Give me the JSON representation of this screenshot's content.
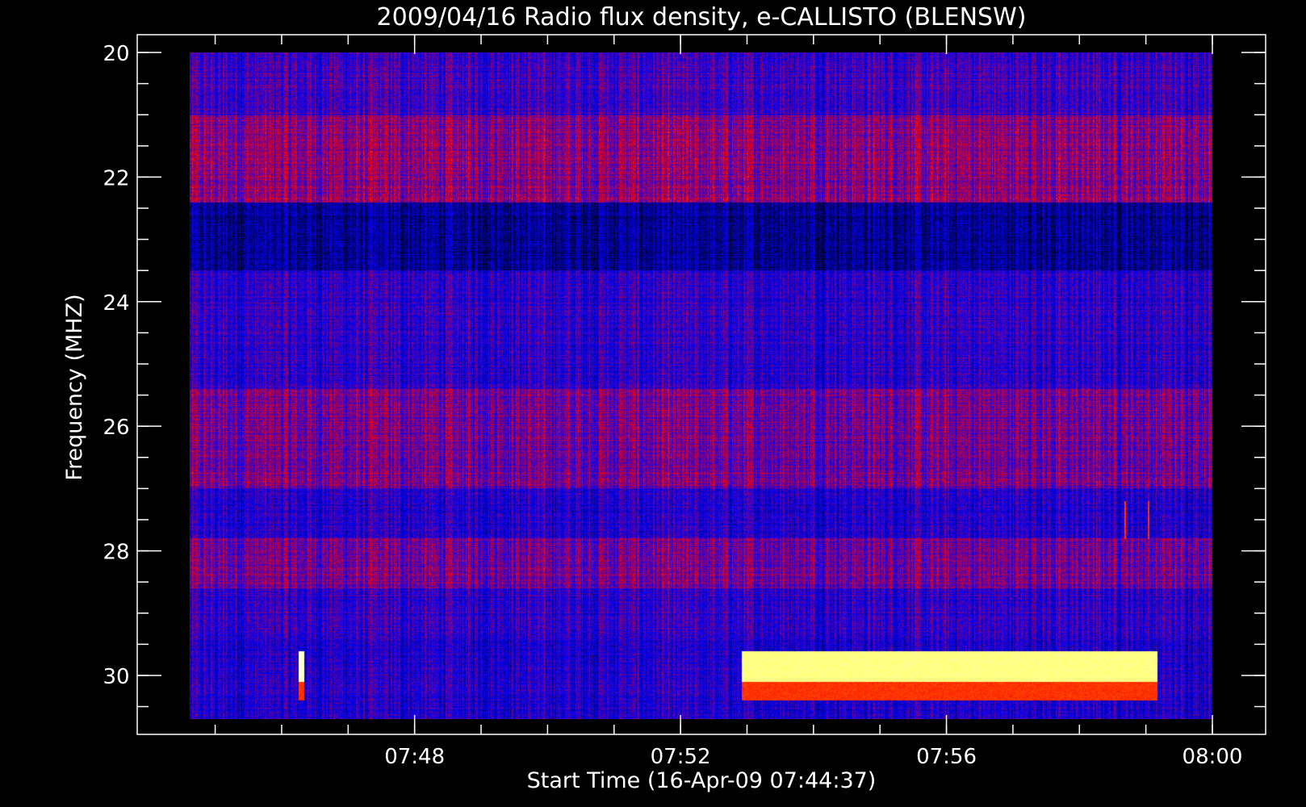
{
  "chart_data": {
    "type": "heatmap",
    "title": "2009/04/16  Radio flux density, e-CALLISTO (BLENSW)",
    "xlabel": "Start Time (16-Apr-09 07:44:37)",
    "ylabel": "Frequency (MHZ)",
    "x_unit": "time",
    "x_range": [
      "07:44:37",
      "08:00:00"
    ],
    "y_range": [
      20,
      30.7
    ],
    "y_inverted": true,
    "x_tick_labels": [
      "07:48",
      "07:52",
      "07:56",
      "08:00"
    ],
    "x_tick_values": [
      "07:48",
      "07:52",
      "07:56",
      "08:00"
    ],
    "x_minor_tick_values": [
      "07:45",
      "07:46",
      "07:47",
      "07:48",
      "07:49",
      "07:50",
      "07:51",
      "07:52",
      "07:53",
      "07:54",
      "07:55",
      "07:56",
      "07:57",
      "07:58",
      "07:59",
      "08:00"
    ],
    "y_tick_labels": [
      "20",
      "22",
      "24",
      "26",
      "28",
      "30"
    ],
    "y_tick_values": [
      20,
      22,
      24,
      26,
      28,
      30
    ],
    "y_minor_tick_values": [
      20,
      20.5,
      21,
      21.5,
      22,
      22.5,
      23,
      23.5,
      24,
      24.5,
      25,
      25.5,
      26,
      26.5,
      27,
      27.5,
      28,
      28.5,
      29,
      29.5,
      30,
      30.5
    ],
    "colormap": [
      "#000000",
      "#0000ff",
      "#ff0000",
      "#ffff00",
      "#ffffff"
    ],
    "background_color": "#000000",
    "grid": false,
    "data_time_range": [
      "07:44:37",
      "08:00:00"
    ],
    "frequency_bands": [
      {
        "from": 20.0,
        "to": 21.0,
        "level": 0.3
      },
      {
        "from": 21.0,
        "to": 22.4,
        "level": 0.38
      },
      {
        "from": 22.4,
        "to": 23.5,
        "level": 0.15
      },
      {
        "from": 23.5,
        "to": 25.4,
        "level": 0.28
      },
      {
        "from": 25.4,
        "to": 27.0,
        "level": 0.36
      },
      {
        "from": 27.0,
        "to": 27.8,
        "level": 0.26
      },
      {
        "from": 27.8,
        "to": 28.6,
        "level": 0.36
      },
      {
        "from": 28.6,
        "to": 29.4,
        "level": 0.28
      },
      {
        "from": 29.4,
        "to": 30.7,
        "level": 0.26
      }
    ],
    "bursts": [
      {
        "start": "07:46:15",
        "end": "07:46:20",
        "f_from": 29.6,
        "f_to": 30.1,
        "level": 0.95
      },
      {
        "start": "07:46:15",
        "end": "07:46:20",
        "f_from": 30.1,
        "f_to": 30.4,
        "level": 0.55
      },
      {
        "start": "07:52:55",
        "end": "07:59:10",
        "f_from": 29.6,
        "f_to": 30.1,
        "level": 0.88
      },
      {
        "start": "07:52:55",
        "end": "07:59:10",
        "f_from": 30.1,
        "f_to": 30.4,
        "level": 0.55
      },
      {
        "start": "07:58:40",
        "end": "07:58:42",
        "f_from": 27.2,
        "f_to": 27.8,
        "level": 0.55
      },
      {
        "start": "07:59:01",
        "end": "07:59:03",
        "f_from": 27.2,
        "f_to": 27.8,
        "level": 0.55
      }
    ]
  }
}
